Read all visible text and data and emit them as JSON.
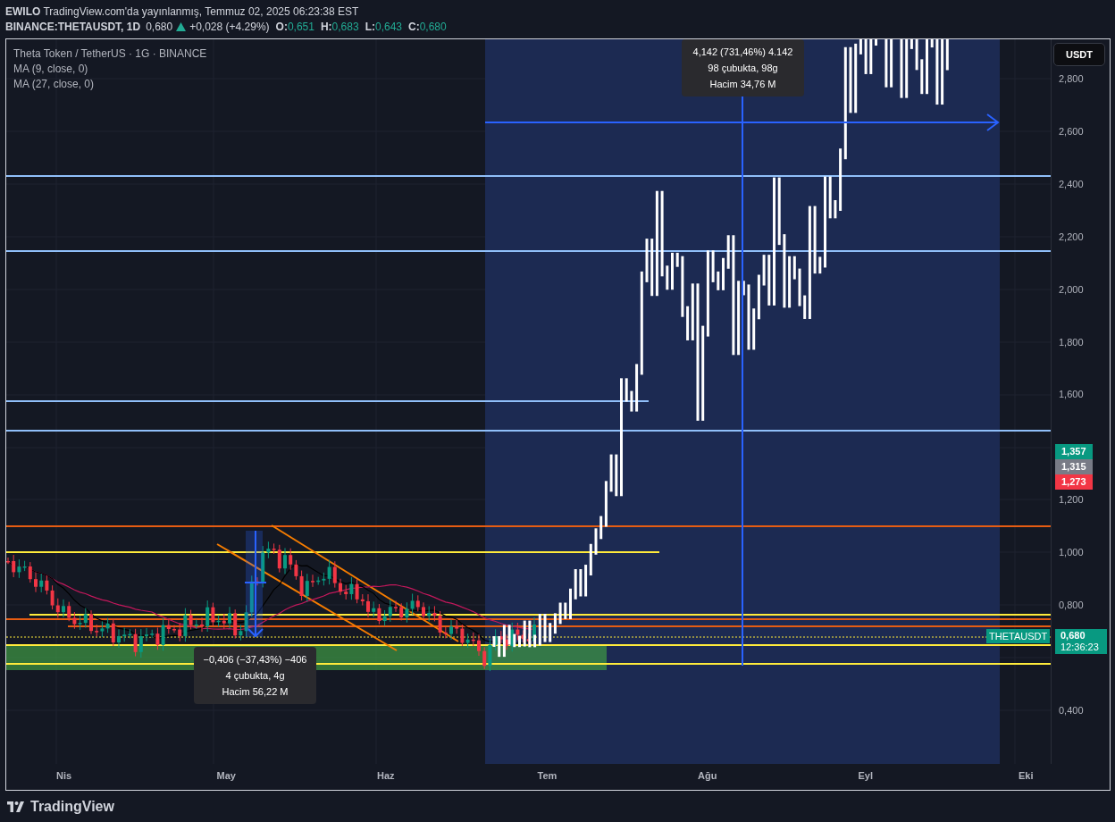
{
  "header": {
    "publish_line": "**EWILO** TradingView.com'da yayınlanmış, Temmuz 02, 2025 06:23:38 EST",
    "symbol": "BINANCE:THETAUSDT, 1D",
    "price": "0,680",
    "change": "+0,028 (+4.29%)",
    "ohlc": [
      {
        "label": "O:",
        "value": "0,651"
      },
      {
        "label": "H:",
        "value": "0,683"
      },
      {
        "label": "L:",
        "value": "0,643"
      },
      {
        "label": "C:",
        "value": "0,680"
      }
    ]
  },
  "legend": {
    "title": "Theta Token / TetherUS · 1G · BINANCE",
    "indicators": [
      "MA (9, close, 0)",
      "MA (27, close, 0)"
    ]
  },
  "currency_button": "USDT",
  "price_axis": {
    "ticks": [
      "2,800",
      "2,600",
      "2,400",
      "2,200",
      "2,000",
      "1,800",
      "1,600",
      "1,200",
      "1,000",
      "0,800",
      "0,400"
    ]
  },
  "price_badges": [
    {
      "text": "1,357",
      "color": "#089981"
    },
    {
      "text": "1,315",
      "color": "#787b86"
    },
    {
      "text": "1,273",
      "color": "#f23645"
    }
  ],
  "last_price": {
    "symbol": "THETAUSDT",
    "price": "0,680",
    "countdown": "12:36:23"
  },
  "measurements": [
    {
      "lines": [
        "−0,406 (−37,43%) −406",
        "4 çubukta, 4g",
        "Hacim 56,22 M"
      ]
    },
    {
      "lines": [
        "4,142 (731,46%) 4.142",
        "98 çubukta, 98g",
        "Hacim 34,76 M"
      ]
    }
  ],
  "time_axis": {
    "labels": [
      "Nis",
      "May",
      "Haz",
      "Tem",
      "Ağu",
      "Eyl",
      "Eki"
    ]
  },
  "footer": {
    "brand": "TradingView"
  }
}
